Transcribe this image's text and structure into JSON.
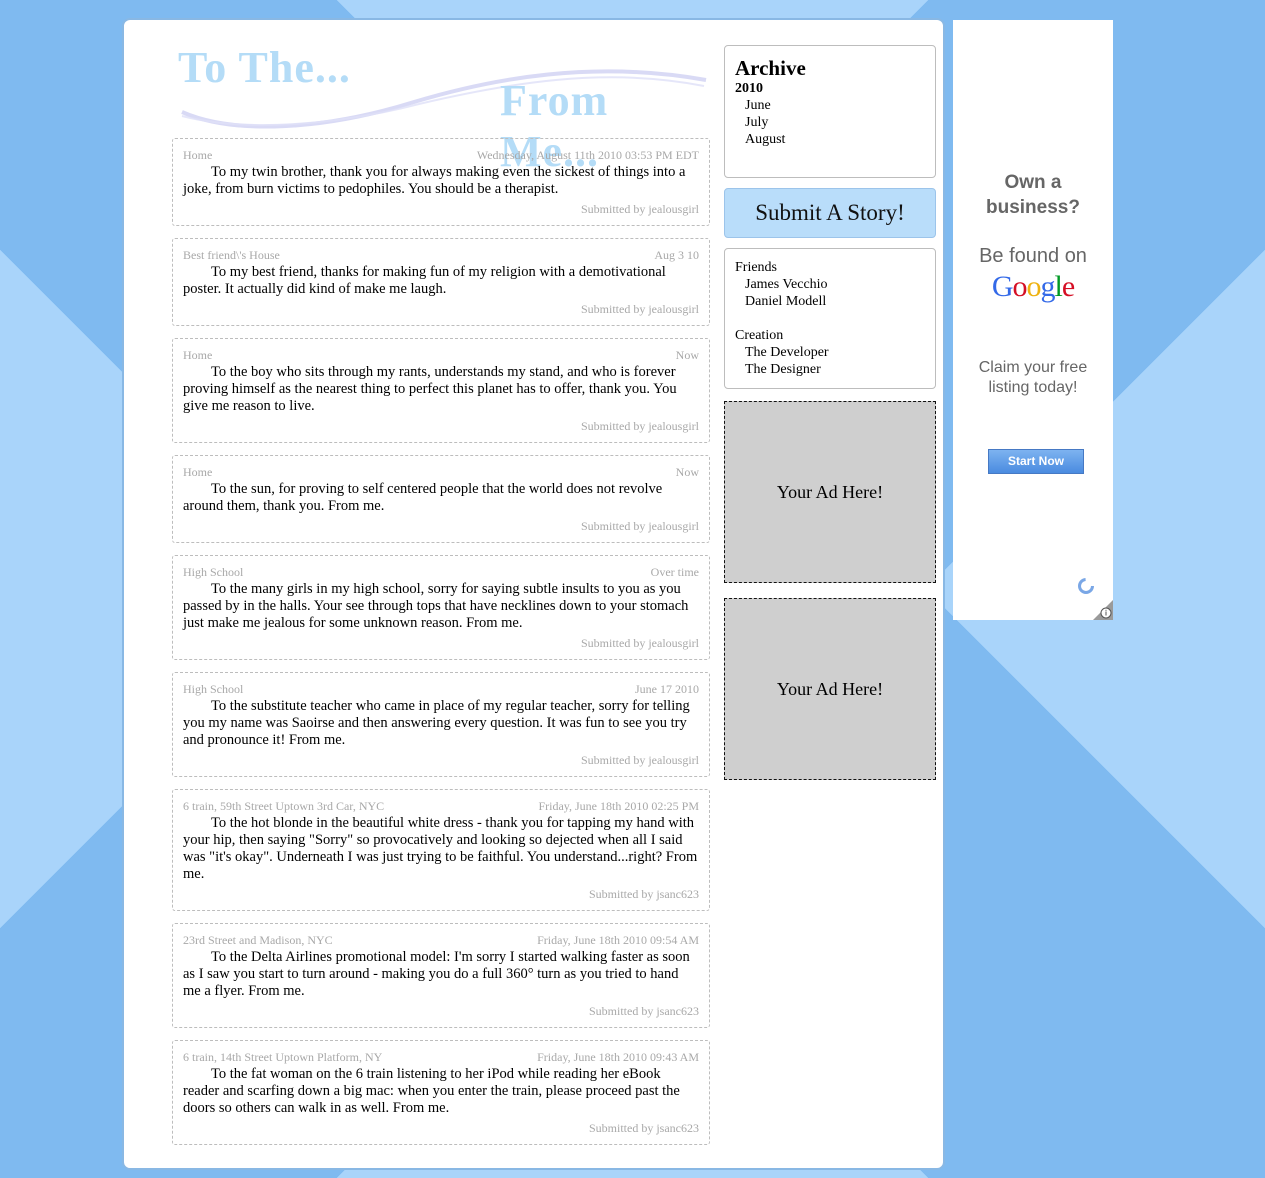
{
  "header": {
    "title_part1": "To The...",
    "title_part2": "From Me..."
  },
  "posts": [
    {
      "location": "Home",
      "date": "Wednesday, August 11th 2010 03:53 PM EDT",
      "text": "To my twin brother, thank you for always making even the sickest of things into a joke, from burn victims to pedophiles. You should be a therapist.",
      "submitted": "Submitted by jealousgirl"
    },
    {
      "location": "Best friend\\'s House",
      "date": "Aug 3 10",
      "text": "To my best friend, thanks for making fun of my religion with a demotivational poster. It actually did kind of make me laugh.",
      "submitted": "Submitted by jealousgirl"
    },
    {
      "location": "Home",
      "date": "Now",
      "text": "To the boy who sits through my rants, understands my stand, and who is forever proving himself as the nearest thing to perfect this planet has to offer, thank you. You give me reason to live.",
      "submitted": "Submitted by jealousgirl"
    },
    {
      "location": "Home",
      "date": "Now",
      "text": "To the sun, for proving to self centered people that the world does not revolve around them, thank you. From me.",
      "submitted": "Submitted by jealousgirl"
    },
    {
      "location": "High School",
      "date": "Over time",
      "text": "To the many girls in my high school, sorry for saying subtle insults to you as you passed by in the halls. Your see through tops that have necklines down to your stomach just make me jealous for some unknown reason. From me.",
      "submitted": "Submitted by jealousgirl"
    },
    {
      "location": "High School",
      "date": "June 17 2010",
      "text": "To the substitute teacher who came in place of my regular teacher, sorry for telling you my name was Saoirse and then answering every question. It was fun to see you try and pronounce it! From me.",
      "submitted": "Submitted by jealousgirl"
    },
    {
      "location": "6 train, 59th Street Uptown 3rd Car, NYC",
      "date": "Friday, June 18th 2010 02:25 PM",
      "text": "To the hot blonde in the beautiful white dress - thank you for tapping my hand with your hip, then saying \"Sorry\" so provocatively and looking so dejected when all I said was \"it's okay\". Underneath I was just trying to be faithful. You understand...right? From me.",
      "submitted": "Submitted by jsanc623"
    },
    {
      "location": "23rd Street and Madison, NYC",
      "date": "Friday, June 18th 2010 09:54 AM",
      "text": "To the Delta Airlines promotional model: I'm sorry I started walking faster as soon as I saw you start to turn around - making you do a full 360° turn as you tried to hand me a flyer. From me.",
      "submitted": "Submitted by jsanc623"
    },
    {
      "location": "6 train, 14th Street Uptown Platform, NY",
      "date": "Friday, June 18th 2010 09:43 AM",
      "text": "To the fat woman on the 6 train listening to her iPod while reading her eBook reader and scarfing down a big mac: when you enter the train, please proceed past the doors so others can walk in as well. From me.",
      "submitted": "Submitted by jsanc623"
    }
  ],
  "archive": {
    "title": "Archive",
    "year": "2010",
    "months": [
      "June",
      "July",
      "August"
    ]
  },
  "submit_label": "Submit A Story!",
  "friends": {
    "title": "Friends",
    "items": [
      "James Vecchio",
      "Daniel Modell"
    ]
  },
  "creation": {
    "title": "Creation",
    "items": [
      "The Developer",
      "The Designer"
    ]
  },
  "ads": [
    "Your Ad Here!",
    "Your Ad Here!"
  ],
  "google_ad": {
    "headline_line1": "Own a",
    "headline_line2": "business?",
    "found": "Be found on",
    "logo": "Google",
    "claim_line1": "Claim your free",
    "claim_line2": "listing today!",
    "button": "Start Now"
  },
  "colors": {
    "background": "#a9d4fa",
    "title": "#b4dcf7",
    "submit_bg": "#b9ddfa"
  }
}
